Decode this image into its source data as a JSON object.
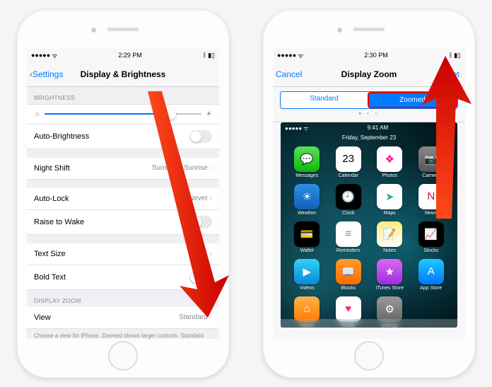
{
  "left": {
    "status": {
      "time": "2:29 PM",
      "signal_icon": "signal-icon",
      "wifi_icon": "wifi-icon",
      "bt_icon": "bluetooth-icon",
      "batt_icon": "battery-icon"
    },
    "nav": {
      "back": "Settings",
      "title": "Display & Brightness"
    },
    "sections": {
      "brightness_header": "BRIGHTNESS",
      "auto_brightness": "Auto-Brightness",
      "night_shift": {
        "label": "Night Shift",
        "value": "Sunset to Sunrise"
      },
      "auto_lock": {
        "label": "Auto-Lock",
        "value": "Never"
      },
      "raise_to_wake": "Raise to Wake",
      "text_size": "Text Size",
      "bold_text": "Bold Text",
      "display_zoom_header": "DISPLAY ZOOM",
      "view": {
        "label": "View",
        "value": "Standard"
      },
      "footer": "Choose a view for iPhone. Zoomed shows larger controls. Standard shows more content."
    }
  },
  "right": {
    "status": {
      "time": "2:30 PM",
      "signal_icon": "signal-icon",
      "wifi_icon": "wifi-icon",
      "bt_icon": "bluetooth-icon",
      "batt_icon": "battery-icon"
    },
    "nav": {
      "cancel": "Cancel",
      "title": "Display Zoom",
      "set": "Set"
    },
    "segments": {
      "standard": "Standard",
      "zoomed": "Zoomed"
    },
    "preview": {
      "status_time": "9:41 AM",
      "date": "Friday, September 23",
      "apps": [
        {
          "label": "Messages",
          "color": "linear-gradient(#5ade5a,#0bbb0b)",
          "glyph": "💬"
        },
        {
          "label": "Calendar",
          "color": "#fff",
          "glyph": "23",
          "text_color": "#000"
        },
        {
          "label": "Photos",
          "color": "#fff",
          "glyph": "❖",
          "text_color": "#f09"
        },
        {
          "label": "Camera",
          "color": "linear-gradient(#888,#555)",
          "glyph": "📷"
        },
        {
          "label": "Weather",
          "color": "linear-gradient(#2b8fe6,#1160b8)",
          "glyph": "☀"
        },
        {
          "label": "Clock",
          "color": "#000",
          "glyph": "🕘"
        },
        {
          "label": "Maps",
          "color": "#fff",
          "glyph": "➤",
          "text_color": "#3a9"
        },
        {
          "label": "News",
          "color": "#fff",
          "glyph": "N",
          "text_color": "#e3002b"
        },
        {
          "label": "Wallet",
          "color": "#000",
          "glyph": "💳"
        },
        {
          "label": "Reminders",
          "color": "#fff",
          "glyph": "≡",
          "text_color": "#888"
        },
        {
          "label": "Notes",
          "color": "linear-gradient(#ffe97a,#fff)",
          "glyph": "📝"
        },
        {
          "label": "Stocks",
          "color": "#000",
          "glyph": "📈"
        },
        {
          "label": "Videos",
          "color": "linear-gradient(#34d1f4,#0a89d8)",
          "glyph": "▶"
        },
        {
          "label": "iBooks",
          "color": "linear-gradient(#ff9a2e,#ff6a00)",
          "glyph": "📖"
        },
        {
          "label": "iTunes Store",
          "color": "linear-gradient(#d86af0,#a22be0)",
          "glyph": "★"
        },
        {
          "label": "App Store",
          "color": "linear-gradient(#1fc8ff,#0076ff)",
          "glyph": "A"
        },
        {
          "label": "Home",
          "color": "linear-gradient(#ffb24a,#ff7a00)",
          "glyph": "⌂"
        },
        {
          "label": "Health",
          "color": "#fff",
          "glyph": "♥",
          "text_color": "#ff2d55"
        },
        {
          "label": "Settings",
          "color": "linear-gradient(#999,#666)",
          "glyph": "⚙"
        }
      ]
    }
  }
}
